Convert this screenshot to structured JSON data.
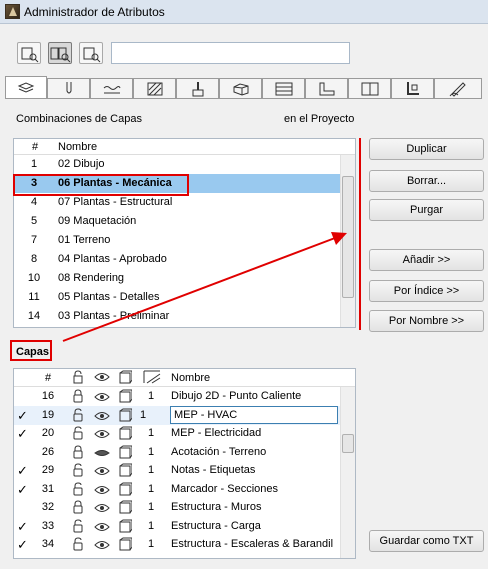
{
  "window": {
    "title": "Administrador de Atributos"
  },
  "search": {
    "value": ""
  },
  "top_section": {
    "label_left": "Combinaciones de Capas",
    "label_right": "en el Proyecto",
    "col_hash": "#",
    "col_name": "Nombre",
    "rows": [
      {
        "num": "1",
        "name": "02 Dibujo"
      },
      {
        "num": "3",
        "name": "06 Plantas - Mecánica"
      },
      {
        "num": "4",
        "name": "07 Plantas - Estructural"
      },
      {
        "num": "5",
        "name": "09 Maquetación"
      },
      {
        "num": "7",
        "name": "01 Terreno"
      },
      {
        "num": "8",
        "name": "04 Plantas - Aprobado"
      },
      {
        "num": "10",
        "name": "08 Rendering"
      },
      {
        "num": "11",
        "name": "05 Plantas - Detalles"
      },
      {
        "num": "14",
        "name": "03 Plantas - Preliminar"
      }
    ]
  },
  "buttons": {
    "duplicar": "Duplicar",
    "borrar": "Borrar...",
    "purgar": "Purgar",
    "anadir": "Añadir >>",
    "por_indice": "Por Índice >>",
    "por_nombre": "Por Nombre >>",
    "guardar_txt": "Guardar como TXT"
  },
  "bottom_section": {
    "label": "Capas",
    "col_hash": "#",
    "col_name": "Nombre",
    "rows": [
      {
        "check": "",
        "num": "16",
        "count": "1",
        "name": "Dibujo 2D - Punto Caliente"
      },
      {
        "check": "✓",
        "num": "19",
        "count": "1",
        "name": "MEP - HVAC"
      },
      {
        "check": "✓",
        "num": "20",
        "count": "1",
        "name": "MEP - Electricidad"
      },
      {
        "check": "",
        "num": "26",
        "count": "1",
        "name": "Acotación - Terreno"
      },
      {
        "check": "✓",
        "num": "29",
        "count": "1",
        "name": "Notas - Etiquetas"
      },
      {
        "check": "✓",
        "num": "31",
        "count": "1",
        "name": "Marcador - Secciones"
      },
      {
        "check": "",
        "num": "32",
        "count": "1",
        "name": "Estructura - Muros"
      },
      {
        "check": "✓",
        "num": "33",
        "count": "1",
        "name": "Estructura - Carga"
      },
      {
        "check": "✓",
        "num": "34",
        "count": "1",
        "name": "Estructura - Escaleras & Barandil"
      }
    ]
  },
  "colors": {
    "selection": "#99c9ef",
    "highlight": "#e00000"
  }
}
